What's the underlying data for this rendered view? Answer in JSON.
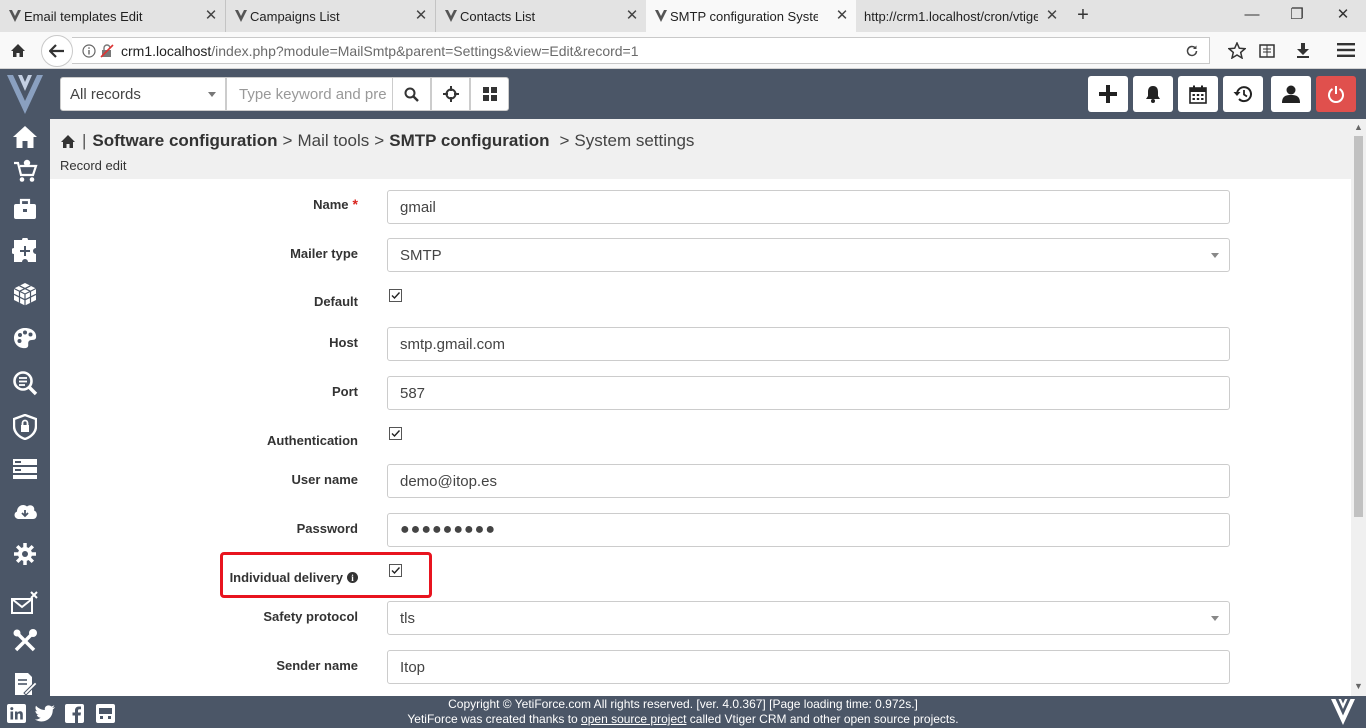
{
  "browser": {
    "tabs": [
      {
        "title": "Email templates Edit",
        "active": false
      },
      {
        "title": "Campaigns List",
        "active": false
      },
      {
        "title": "Contacts List",
        "active": false
      },
      {
        "title": "SMTP configuration System",
        "active": true
      },
      {
        "title": "http://crm1.localhost/cron/vtige",
        "active": false
      }
    ],
    "url_host": "crm1.localhost",
    "url_path": "/index.php?module=MailSmtp&parent=Settings&view=Edit&record=1"
  },
  "header": {
    "records_select": "All records",
    "search_placeholder": "Type keyword and pre"
  },
  "breadcrumb": {
    "item1": "Software configuration",
    "sep1": ">",
    "item2": "Mail tools",
    "sep2": ">",
    "item3": "SMTP configuration",
    "sep3": ">",
    "item4": "System settings",
    "subtitle": "Record edit"
  },
  "form": {
    "name": {
      "label": "Name",
      "required": "*",
      "value": "gmail"
    },
    "mailer_type": {
      "label": "Mailer type",
      "value": "SMTP"
    },
    "default": {
      "label": "Default",
      "checked": true
    },
    "host": {
      "label": "Host",
      "value": "smtp.gmail.com"
    },
    "port": {
      "label": "Port",
      "value": "587"
    },
    "authentication": {
      "label": "Authentication",
      "checked": true
    },
    "username": {
      "label": "User name",
      "value": "demo@itop.es"
    },
    "password": {
      "label": "Password",
      "value": "●●●●●●●●●"
    },
    "individual_delivery": {
      "label": "Individual delivery",
      "info": "i",
      "checked": true
    },
    "safety_protocol": {
      "label": "Safety protocol",
      "value": "tls"
    },
    "sender_name": {
      "label": "Sender name",
      "value": "Itop"
    }
  },
  "footer": {
    "line1": "Copyright © YetiForce.com All rights reserved. [ver. 4.0.367] [Page loading time: 0.972s.]",
    "line2_a": "YetiForce was created thanks to ",
    "line2_link": "open source project",
    "line2_b": " called Vtiger CRM and other open source projects."
  },
  "colors": {
    "header_bg": "#4b5667",
    "highlight": "#e8141f",
    "power_button": "#e0504d"
  },
  "icons": [
    "home-icon",
    "back-icon",
    "info-icon",
    "insecure-lock-icon",
    "reload-icon",
    "star-icon",
    "reader-icon",
    "download-icon",
    "menu-icon",
    "search-icon",
    "crosshair-icon",
    "grid-icon",
    "plus-icon",
    "bell-icon",
    "calendar-icon",
    "history-icon",
    "user-icon",
    "power-icon"
  ]
}
